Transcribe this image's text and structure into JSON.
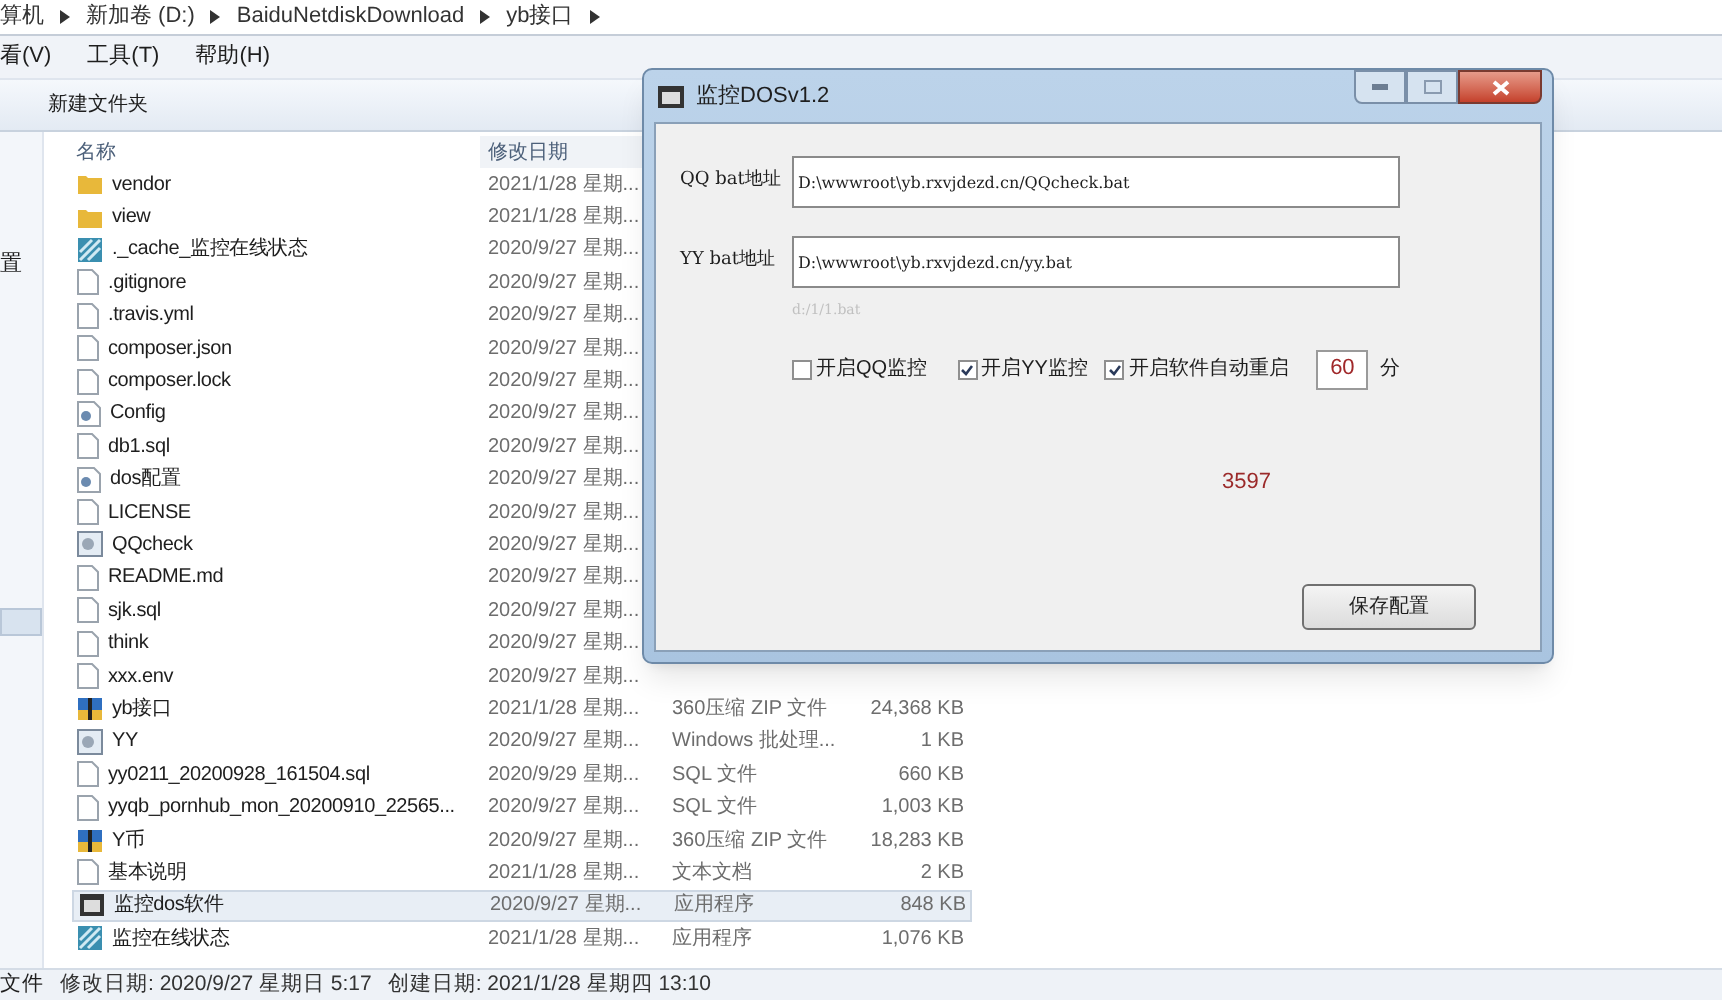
{
  "breadcrumb": [
    "算机",
    "新加卷 (D:)",
    "BaiduNetdiskDownload",
    "yb接口"
  ],
  "menu": [
    "看(V)",
    "工具(T)",
    "帮助(H)"
  ],
  "toolbar": [
    "新建文件夹"
  ],
  "nav_pane": [
    {
      "label": "置",
      "selected": false
    },
    {
      "selected": true
    }
  ],
  "columns": [
    "名称",
    "修改日期"
  ],
  "files": [
    {
      "name": "vendor",
      "date": "2021/1/28 星期...",
      "kind": "folder",
      "selected": false
    },
    {
      "name": "view",
      "date": "2021/1/28 星期...",
      "kind": "folder",
      "selected": false
    },
    {
      "name": "._cache_监控在线状态",
      "date": "2020/9/27 星期...",
      "kind": "app2",
      "selected": false
    },
    {
      "name": ".gitignore",
      "date": "2020/9/27 星期...",
      "kind": "file",
      "selected": false
    },
    {
      "name": ".travis.yml",
      "date": "2020/9/27 星期...",
      "kind": "file",
      "selected": false
    },
    {
      "name": "composer.json",
      "date": "2020/9/27 星期...",
      "kind": "file",
      "selected": false
    },
    {
      "name": "composer.lock",
      "date": "2020/9/27 星期...",
      "kind": "file",
      "selected": false
    },
    {
      "name": "Config",
      "date": "2020/9/27 星期...",
      "kind": "config",
      "selected": false
    },
    {
      "name": "db1.sql",
      "date": "2020/9/27 星期...",
      "kind": "file",
      "selected": false
    },
    {
      "name": "dos配置",
      "date": "2020/9/27 星期...",
      "kind": "config",
      "selected": false
    },
    {
      "name": "LICENSE",
      "date": "2020/9/27 星期...",
      "kind": "file",
      "selected": false
    },
    {
      "name": "QQcheck",
      "date": "2020/9/27 星期...",
      "kind": "batch",
      "selected": false
    },
    {
      "name": "README.md",
      "date": "2020/9/27 星期...",
      "kind": "file",
      "selected": false
    },
    {
      "name": "sjk.sql",
      "date": "2020/9/27 星期...",
      "kind": "file",
      "selected": false
    },
    {
      "name": "think",
      "date": "2020/9/27 星期...",
      "kind": "file",
      "selected": false
    },
    {
      "name": "xxx.env",
      "date": "2020/9/27 星期...",
      "kind": "file",
      "selected": false
    },
    {
      "name": "yb接口",
      "date": "2021/1/28 星期...",
      "type": "360压缩 ZIP 文件",
      "size": "24,368 KB",
      "kind": "zip",
      "selected": false
    },
    {
      "name": "YY",
      "date": "2020/9/27 星期...",
      "type": "Windows 批处理...",
      "size": "1 KB",
      "kind": "batch",
      "selected": false
    },
    {
      "name": "yy0211_20200928_161504.sql",
      "date": "2020/9/29 星期...",
      "type": "SQL 文件",
      "size": "660 KB",
      "kind": "file",
      "selected": false
    },
    {
      "name": "yyqb_pornhub_mon_20200910_22565...",
      "date": "2020/9/27 星期...",
      "type": "SQL 文件",
      "size": "1,003 KB",
      "kind": "file",
      "selected": false
    },
    {
      "name": "Y币",
      "date": "2020/9/27 星期...",
      "type": "360压缩 ZIP 文件",
      "size": "18,283 KB",
      "kind": "zip",
      "selected": false
    },
    {
      "name": "基本说明",
      "date": "2021/1/28 星期...",
      "type": "文本文档",
      "size": "2 KB",
      "kind": "file",
      "selected": false
    },
    {
      "name": "监控dos软件",
      "date": "2020/9/27 星期...",
      "type": "应用程序",
      "size": "848 KB",
      "kind": "app",
      "selected": true
    },
    {
      "name": "监控在线状态",
      "date": "2021/1/28 星期...",
      "type": "应用程序",
      "size": "1,076 KB",
      "kind": "app2",
      "selected": false
    }
  ],
  "status_bar": {
    "name": "文件",
    "modified": "修改日期: 2020/9/27 星期日 5:17",
    "created": "创建日期: 2021/1/28 星期四 13:10"
  },
  "dialog": {
    "title": "监控DOSv1.2",
    "fields": [
      {
        "label": "QQ bat地址",
        "value": "D:\\wwwroot\\yb.rxvjdezd.cn/QQcheck.bat"
      },
      {
        "label": "YY bat地址",
        "value": "D:\\wwwroot\\yb.rxvjdezd.cn/yy.bat"
      }
    ],
    "hint": "d:/1/1.bat",
    "checkboxes": [
      {
        "label": "开启QQ监控",
        "checked": false
      },
      {
        "label": "开启YY监控",
        "checked": true
      },
      {
        "label": "开启软件自动重启",
        "checked": true
      }
    ],
    "restart_minutes": "60",
    "minutes_unit": "分",
    "counter": "3597",
    "save_button": "保存配置"
  }
}
